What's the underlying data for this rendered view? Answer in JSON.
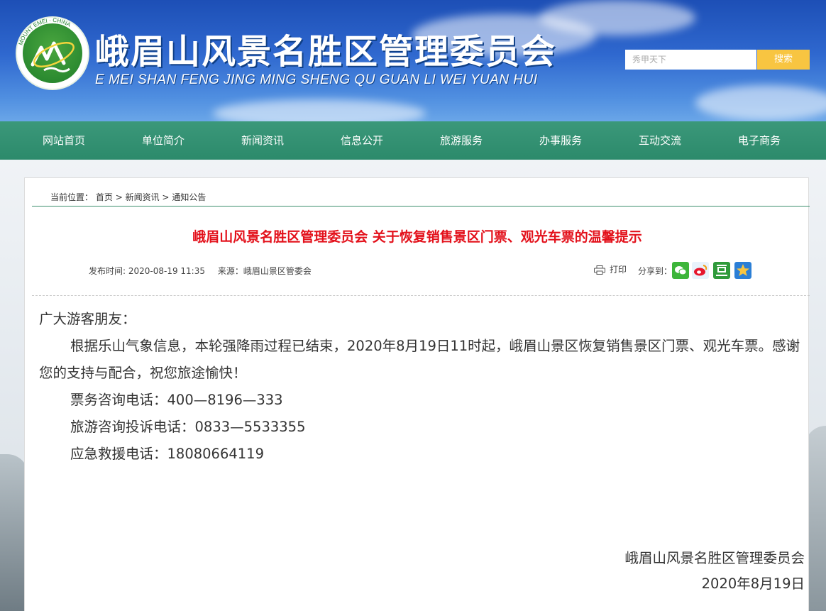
{
  "header": {
    "logo_ring_text": "MOUNT EMEI · CHINA",
    "title": "峨眉山风景名胜区管理委员会",
    "subtitle": "E MEI SHAN FENG JING MING SHENG QU GUAN LI WEI YUAN HUI",
    "search_placeholder": "秀甲天下",
    "search_button": "搜索"
  },
  "nav": {
    "items": [
      "网站首页",
      "单位简介",
      "新闻资讯",
      "信息公开",
      "旅游服务",
      "办事服务",
      "互动交流",
      "电子商务"
    ]
  },
  "breadcrumb": {
    "label": "当前位置：",
    "items": [
      "首页",
      "新闻资讯",
      "通知公告"
    ],
    "separator": ">"
  },
  "article": {
    "title": "峨眉山风景名胜区管理委员会 关于恢复销售景区门票、观光车票的温馨提示",
    "publish_time": "发布时间: 2020-08-19 11:35",
    "source": "来源：峨眉山景区管委会",
    "print_label": "打印",
    "share_label": "分享到：",
    "share_icons": [
      "wechat-icon",
      "weibo-icon",
      "douban-icon",
      "qzone-icon"
    ],
    "greeting": "广大游客朋友：",
    "para1": "根据乐山气象信息，本轮强降雨过程已结束，2020年8月19日11时起，峨眉山景区恢复销售景区门票、观光车票。感谢您的支持与配合，祝您旅途愉快！",
    "ticket_phone": "票务咨询电话：400—8196—333",
    "complaint_phone": "旅游咨询投诉电话：0833—5533355",
    "rescue_phone": "应急救援电话：18080664119",
    "signature": "峨眉山风景名胜区管理委员会",
    "date": "2020年8月19日"
  },
  "colors": {
    "header_blue": "#2f68cf",
    "nav_green": "#2c8a6b",
    "title_red": "#e3111b",
    "search_yellow": "#f8c541"
  }
}
